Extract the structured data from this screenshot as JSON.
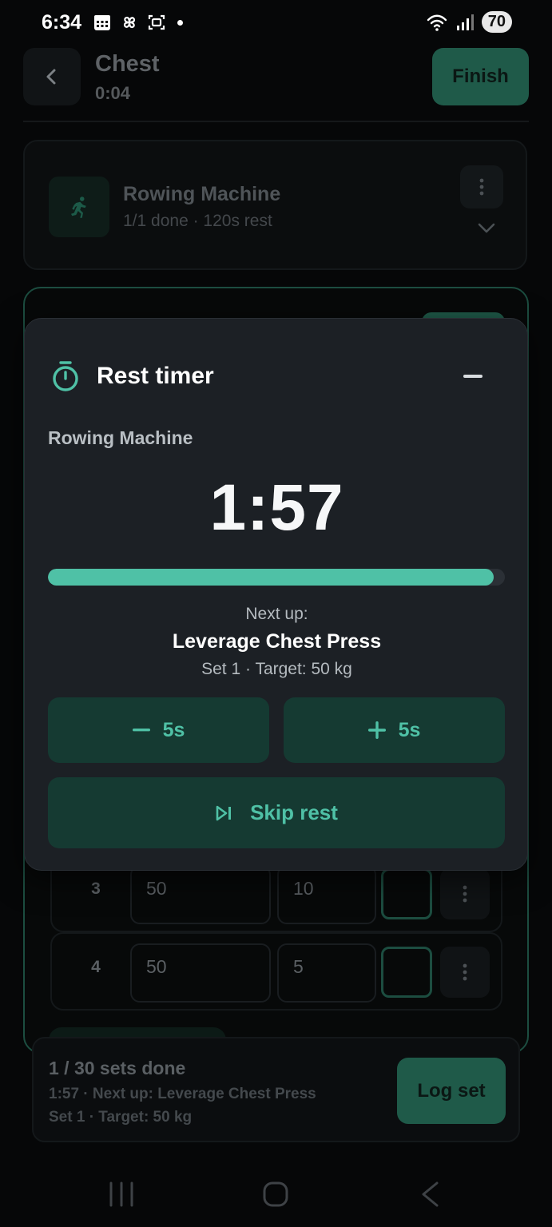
{
  "status_bar": {
    "time": "6:34",
    "battery": "70"
  },
  "header": {
    "title": "Chest",
    "elapsed": "0:04",
    "finish_label": "Finish"
  },
  "previous_exercise": {
    "name": "Rowing Machine",
    "meta": "1/1 done · 120s rest"
  },
  "sets": [
    {
      "number": "3",
      "weight": "50",
      "reps": "10"
    },
    {
      "number": "4",
      "weight": "50",
      "reps": "5"
    }
  ],
  "rest_timer": {
    "title": "Rest timer",
    "exercise": "Rowing Machine",
    "countdown": "1:57",
    "progress_fraction": 0.975,
    "next_label": "Next up:",
    "next_exercise": "Leverage Chest Press",
    "next_detail": "Set 1 · Target: 50 kg",
    "minus_label": "5s",
    "plus_label": "5s",
    "skip_label": "Skip rest"
  },
  "summary": {
    "title": "1 / 30 sets done",
    "line1": "1:57 · Next up: Leverage Chest Press",
    "line2": "Set 1 · Target: 50 kg",
    "log_label": "Log set"
  },
  "colors": {
    "accent": "#4fc1a6",
    "accent_dark": "#153a32",
    "modal_bg": "#1c2025"
  },
  "icons": [
    "calendar-icon",
    "pinwheel-icon",
    "screenshot-icon",
    "wifi-icon",
    "signal-icon",
    "back-icon",
    "runner-icon",
    "more-vertical-icon",
    "chevron-down-icon",
    "stopwatch-icon",
    "minus-icon",
    "plus-icon",
    "skip-icon",
    "nav-recents-icon",
    "nav-home-icon",
    "nav-back-icon"
  ]
}
